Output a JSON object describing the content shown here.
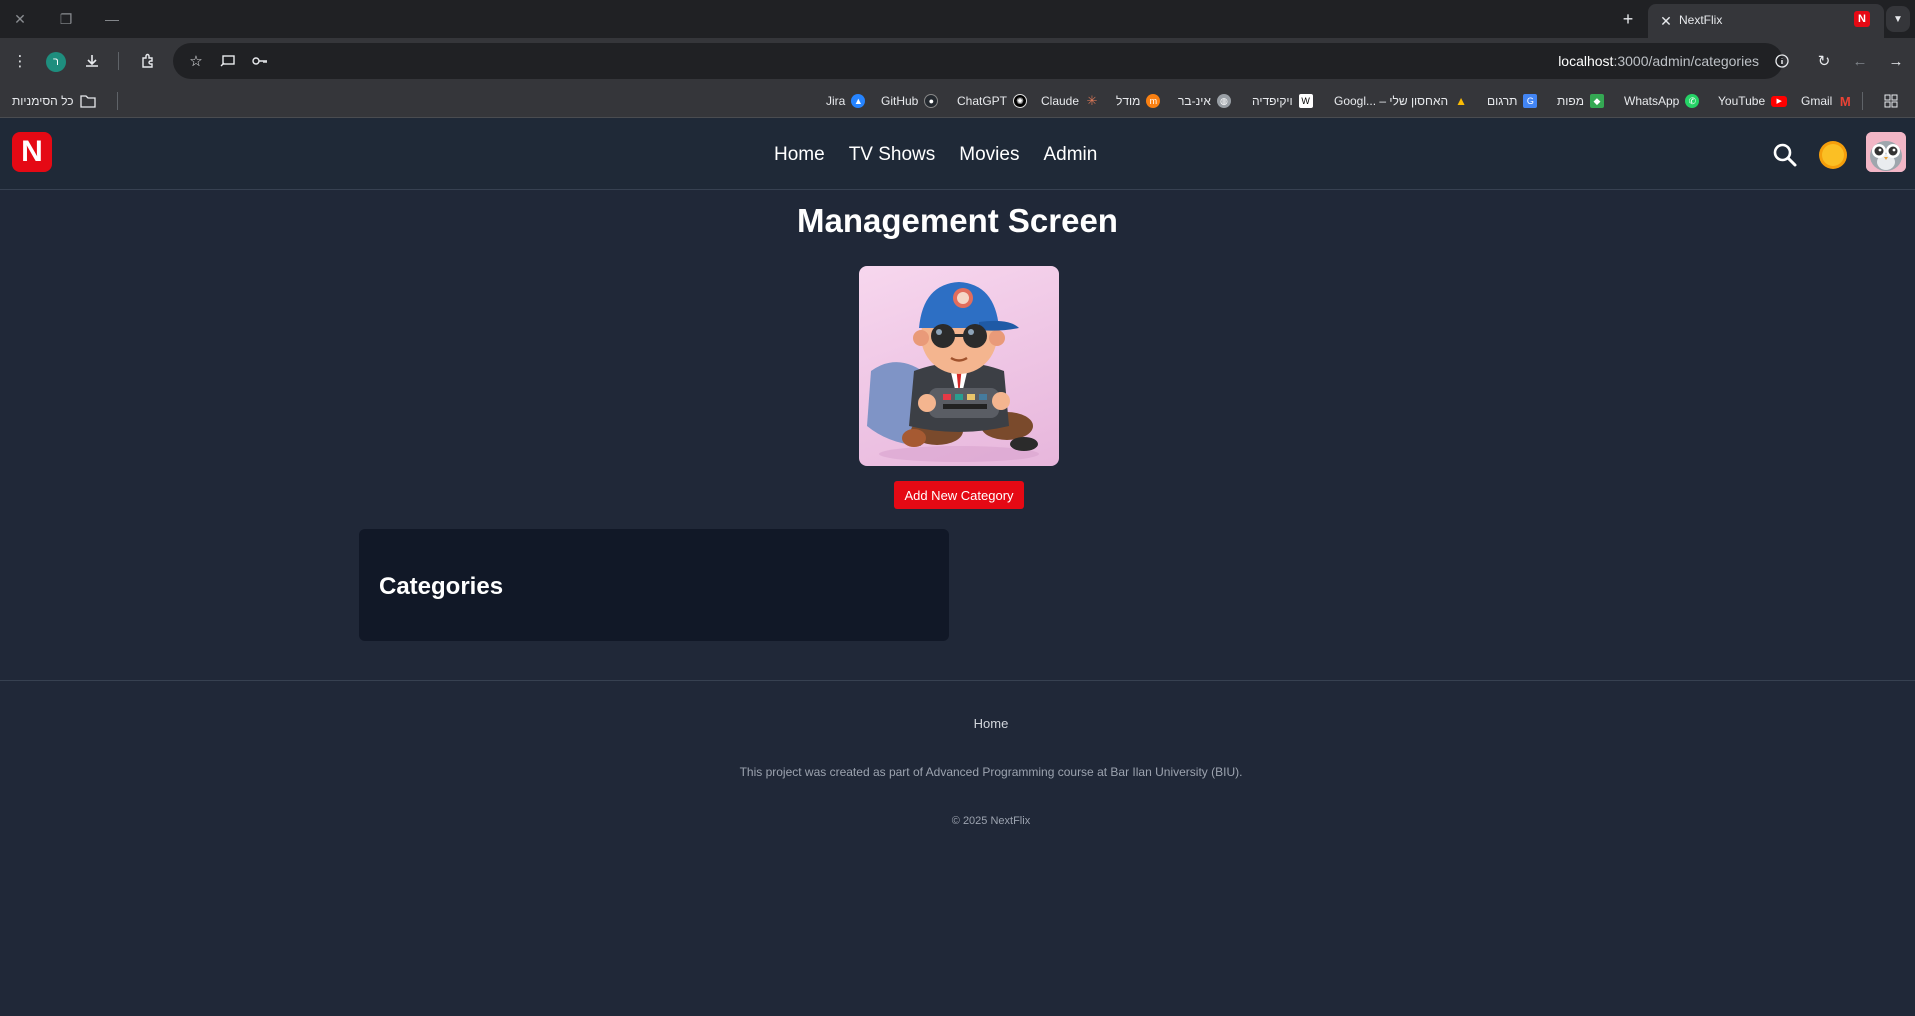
{
  "browser": {
    "tab_title": "NextFlix",
    "tab_favicon": "N",
    "url_host": "localhost",
    "url_path": ":3000/admin/categories",
    "profile_initial": "ר",
    "all_bookmarks_label": "כל הסימניות",
    "bookmarks": [
      {
        "label": "Jira",
        "icon": "jira-icon",
        "color": "#2684ff"
      },
      {
        "label": "GitHub",
        "icon": "github-icon",
        "color": "#24292f"
      },
      {
        "label": "ChatGPT",
        "icon": "chatgpt-icon",
        "color": "#10a37f"
      },
      {
        "label": "Claude",
        "icon": "claude-icon",
        "color": "#d97757"
      },
      {
        "label": "מודל",
        "icon": "moodle-icon",
        "color": "#f98012"
      },
      {
        "label": "אינ-בר",
        "icon": "globe-icon",
        "color": "#5f6368"
      },
      {
        "label": "ויקיפדיה",
        "icon": "wikipedia-icon",
        "color": "#ffffff"
      },
      {
        "label": "Googl... – האחסון שלי",
        "icon": "drive-icon",
        "color": "#34a853"
      },
      {
        "label": "תרגום",
        "icon": "translate-icon",
        "color": "#4285f4"
      },
      {
        "label": "מפות",
        "icon": "maps-icon",
        "color": "#34a853"
      },
      {
        "label": "WhatsApp",
        "icon": "whatsapp-icon",
        "color": "#25d366"
      },
      {
        "label": "YouTube",
        "icon": "youtube-icon",
        "color": "#ff0000"
      },
      {
        "label": "Gmail",
        "icon": "gmail-icon",
        "color": "#ea4335"
      }
    ]
  },
  "site": {
    "logo_letter": "N",
    "brand_color": "#e50914",
    "nav": [
      {
        "label": "Home"
      },
      {
        "label": "TV Shows"
      },
      {
        "label": "Movies"
      },
      {
        "label": "Admin"
      }
    ]
  },
  "main": {
    "title": "Management Screen",
    "add_button_label": "Add New Category",
    "categories_heading": "Categories"
  },
  "footer": {
    "home_link": "Home",
    "note": "This project was created as part of Advanced Programming course at Bar Ilan University (BIU).",
    "copyright": "© 2025 NextFlix"
  }
}
